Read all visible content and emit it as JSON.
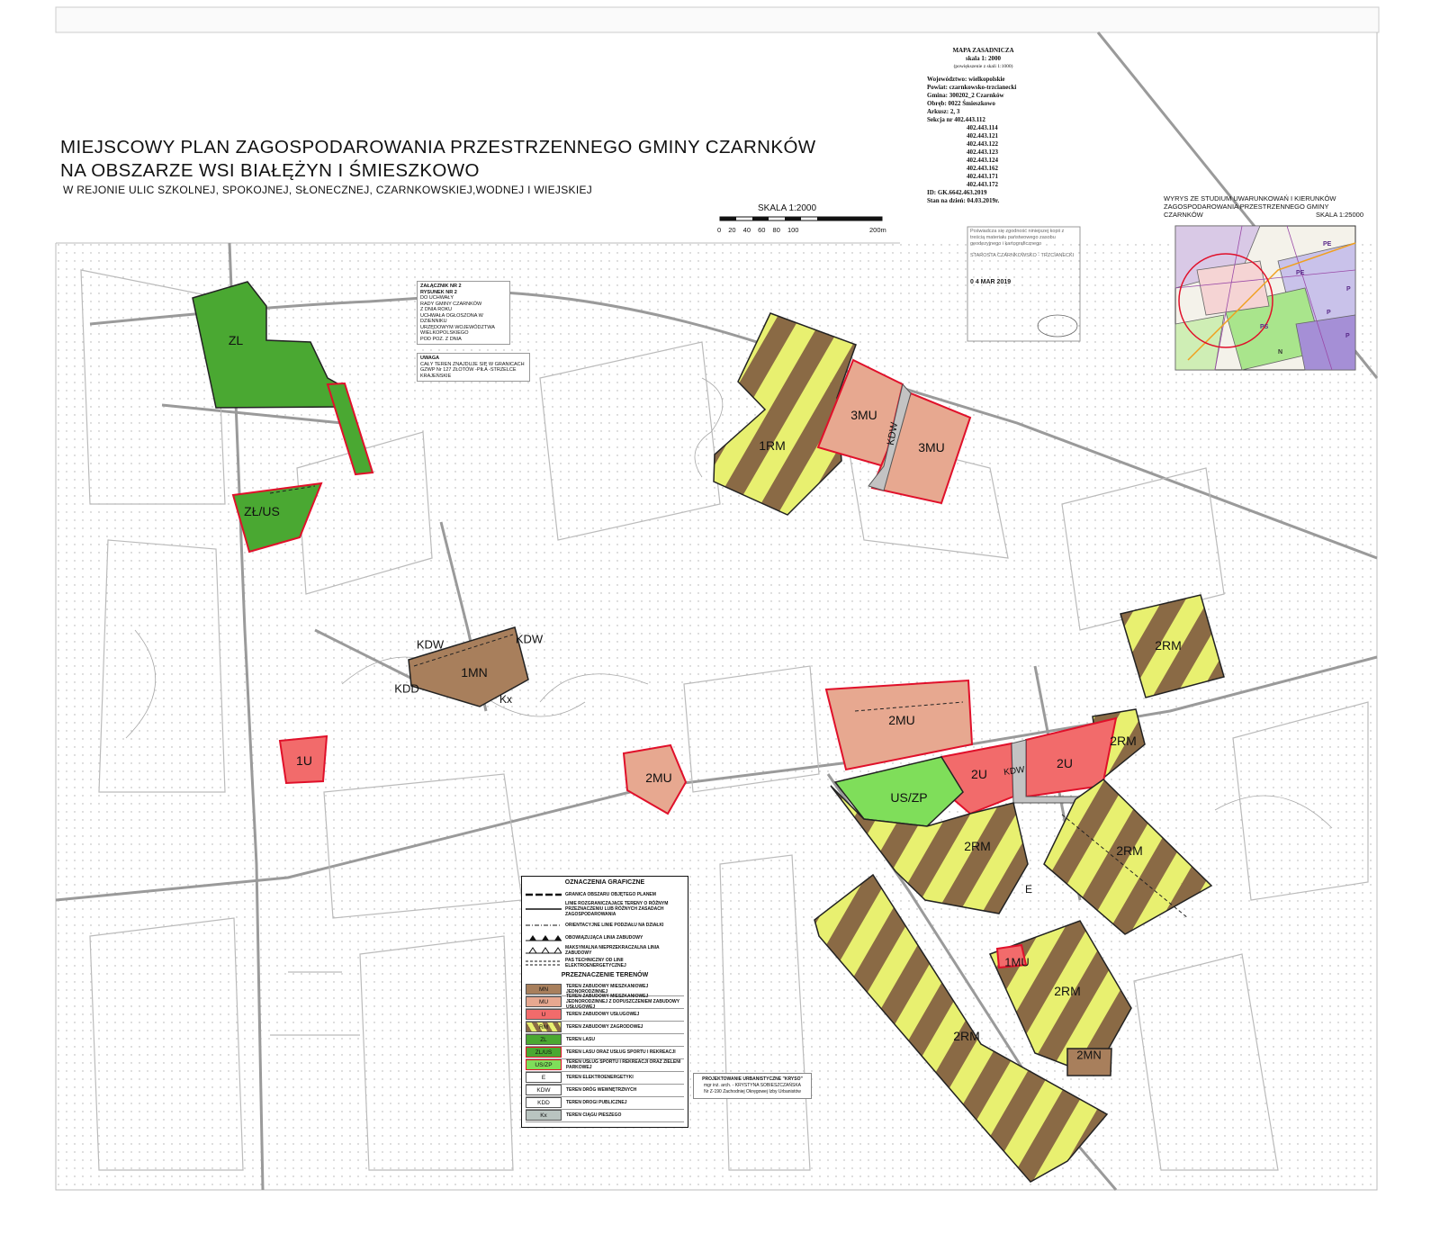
{
  "header": {
    "title_line1": "MIEJSCOWY  PLAN  ZAGOSPODAROWANIA  PRZESTRZENNEGO GMINY CZARNKÓW",
    "title_line2": "NA OBSZARZE WSI BIAŁĘŻYN I ŚMIESZKOWO",
    "subtitle": "W REJONIE ULIC  SZKOLNEJ, SPOKOJNEJ, SŁONECZNEJ, CZARNKOWSKIEJ,WODNEJ I WIEJSKIEJ"
  },
  "scale_bar": {
    "label": "SKALA 1:2000",
    "ticks": "0  20  40  60  80  100",
    "end": "200m"
  },
  "sheet_info": {
    "title": "MAPA  ZASADNICZA",
    "scale": "skala  1: 2000",
    "scale_note": "(powiększenie z skali 1:1000)",
    "wojewodztwo": "Województwo: wielkopolskie",
    "powiat": "Powiat: czarnkowsko-trzcianecki",
    "gmina": "Gmina: 300202_2 Czarnków",
    "obreb": "Obręb: 0022 Śmieszkowo",
    "arkusz": "Arkusz: 2, 3",
    "sekcja": "Sekcja nr 402.443.112",
    "sections": [
      "402.443.114",
      "402.443.121",
      "402.443.122",
      "402.443.123",
      "402.443.124",
      "402.443.162",
      "402.443.171",
      "402.443.172"
    ],
    "id": "ID: GK.6642.463.2019",
    "stan": "Stan na dzień: 04.03.2019r."
  },
  "wyrys": {
    "line1": "WYRYS ZE STUDIUM UWARUNKOWAŃ I KIERUNKÓW",
    "line2": "ZAGOSPODAROWANIA  PRZESTRZENNEGO  GMINY",
    "line3_left": "CZARNKÓW",
    "line3_right": "SKALA 1:25000",
    "labels": [
      "PE",
      "PE",
      "P",
      "P",
      "PS",
      "N",
      "P"
    ]
  },
  "stamp": {
    "text": "Poświadcza się zgodność niniejszej kopii z treścią materiału państwowego zasobu geodezyjnego i kartograficznego",
    "office": "STAROSTA CZARNKOWSKO - TRZCIANECKI",
    "date": "0 4  MAR 2019"
  },
  "annex": {
    "l1": "ZAŁĄCZNIK NR 2",
    "l2": "RYSUNEK NR 2",
    "l3": "DO UCHWAŁY",
    "l4": "RADY GMINY  CZARNKÓW",
    "l5": "Z DNIA                    ROKU",
    "l6": "UCHWAŁA OGŁOSZONA W DZIENNIKU",
    "l7": "URZĘDOWYM WOJEWÓDZTWA",
    "l8": "WIELKOPOLSKIEGO",
    "l9": "POD POZ.              Z DNIA"
  },
  "uwaga": {
    "head": "UWAGA",
    "body": "CAŁY TEREN ZNAJDUJE SIĘ W GRANICACH GZWP Nr 127 ZŁOTÓW -PIŁA -STRZELCE KRAJEŃSKIE"
  },
  "zones": [
    "ZL",
    "ZŁ/US",
    "3MU",
    "3MU",
    "KDW",
    "1RM",
    "KDW",
    "KDW",
    "1MN",
    "KDD",
    "Kx",
    "1U",
    "2MU",
    "2MU",
    "2RM",
    "2RM",
    "US/ZP",
    "2U",
    "KDW",
    "2U",
    "2RM",
    "2RM",
    "2RM",
    "E",
    "2RM",
    "1MU",
    "2RM",
    "2MN"
  ],
  "legend": {
    "title": "OZNACZENIA GRAFICZNE",
    "symbols": [
      "GRANICA OBSZARU OBJĘTEGO PLANEM",
      "LINIE ROZGRANICZAJĄCE TERENY O RÓŻNYM PRZEZNACZENIU LUB RÓŻNYCH ZASADACH ZAGOSPODAROWANIA",
      "ORIENTACYJNE LINIE PODZIAŁU NA DZIAŁKI",
      "OBOWIĄZUJĄCA LINIA ZABUDOWY",
      "MAKSYMALNA NIEPRZEKRACZALNA LINIA ZABUDOWY",
      "PAS TECHNICZNY OD LINII ELEKTROENERGETYCZNEJ"
    ],
    "zones_title": "PRZEZNACZENIE TERENÓW",
    "items": [
      {
        "code": "MN",
        "text": "TEREN ZABUDOWY MIESZKANIOWEJ JEDNORODZINNEJ",
        "color": "#a87f5c"
      },
      {
        "code": "MU",
        "text": "TEREN ZABUDOWY MIESZKANIOWEJ JEDNORODZINNEJ Z DOPUSZCZENIEM ZABUDOWY USŁUGOWEJ",
        "color": "#e7a890"
      },
      {
        "code": "U",
        "text": "TEREN ZABUDOWY USŁUGOWEJ",
        "color": "#f26b6b"
      },
      {
        "code": "RM",
        "text": "TEREN ZABUDOWY  ZAGRODOWEJ",
        "color": "#e8f070"
      },
      {
        "code": "ZL",
        "text": "TEREN LASU",
        "color": "#4aa832"
      },
      {
        "code": "ZL/US",
        "text": "TEREN LASU ORAZ USŁUG SPORTU I REKREACJI",
        "color": "#4aa832"
      },
      {
        "code": "US/ZP",
        "text": "TEREN  USŁUG  SPORTU  I  REKREACJI ORAZ  ZIELENI  PARKOWEJ",
        "color": "#7fde5a"
      },
      {
        "code": "E",
        "text": "TEREN ELEKTROENERGETYKI",
        "color": "#ffffff"
      },
      {
        "code": "KDW",
        "text": "TEREN DRÓG WEWNĘTRZNYCH",
        "color": "#ffffff"
      },
      {
        "code": "KDD",
        "text": "TEREN DROGI PUBLICZNEJ",
        "color": "#ffffff"
      },
      {
        "code": "Kx",
        "text": "TEREN CIĄGU PIESZEGO",
        "color": "#b9c4c0"
      }
    ]
  },
  "designer": {
    "l1": "PROJEKTOWANIE URBANISTYCZNE \"KRYSO\"",
    "l2": "mgr inż. arch. - KRYSTYNA SOBIESZCZAŃSKA",
    "l3": "Nr Z-190 Zachodniej Okręgowej Izby Urbanistów"
  },
  "colors": {
    "forest": "#4aa832",
    "service": "#f26b6b",
    "mixed": "#e7a890",
    "farm_yellow": "#e8f070",
    "farm_brown": "#8a6a45",
    "single_family": "#a87f5c",
    "park": "#7fde5a",
    "outline": "#e0102a",
    "road": "#c3c3c3"
  }
}
